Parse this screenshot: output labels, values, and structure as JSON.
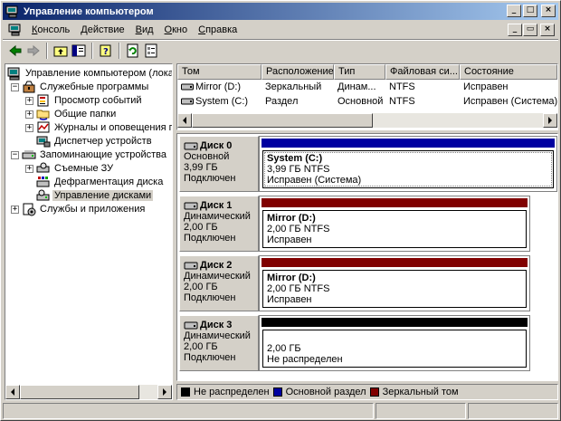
{
  "window": {
    "title": "Управление компьютером",
    "minimize_glyph": "_",
    "maximize_glyph": "□",
    "close_glyph": "×",
    "mdi_minimize_glyph": "_",
    "mdi_restore_glyph": "▭",
    "mdi_close_glyph": "×"
  },
  "menu": {
    "items": [
      {
        "underline": "К",
        "rest": "онсоль"
      },
      {
        "underline": "Д",
        "rest": "ействие"
      },
      {
        "underline": "В",
        "rest": "ид"
      },
      {
        "underline": "О",
        "rest": "кно"
      },
      {
        "underline": "С",
        "rest": "правка"
      }
    ]
  },
  "toolbar": {
    "icons": [
      "back-arrow-icon",
      "forward-arrow-icon",
      "up-folder-icon",
      "show-hide-tree-icon",
      "help-icon",
      "refresh-icon",
      "properties-icon"
    ]
  },
  "tree": {
    "items": [
      {
        "label": "Управление компьютером (локаль",
        "expander": "",
        "icon": "computer-management-icon"
      },
      {
        "label": "Служебные программы",
        "expander": "−",
        "icon": "system-tools-icon"
      },
      {
        "label": "Просмотр событий",
        "expander": "+",
        "icon": "event-viewer-icon"
      },
      {
        "label": "Общие папки",
        "expander": "+",
        "icon": "shared-folders-icon"
      },
      {
        "label": "Журналы и оповещения пр",
        "expander": "+",
        "icon": "logs-alerts-icon"
      },
      {
        "label": "Диспетчер устройств",
        "expander": "",
        "icon": "device-manager-icon"
      },
      {
        "label": "Запоминающие устройства",
        "expander": "−",
        "icon": "storage-icon"
      },
      {
        "label": "Съемные ЗУ",
        "expander": "+",
        "icon": "removable-storage-icon"
      },
      {
        "label": "Дефрагментация диска",
        "expander": "",
        "icon": "defrag-icon"
      },
      {
        "label": "Управление дисками",
        "expander": "",
        "icon": "disk-management-icon"
      },
      {
        "label": "Службы и приложения",
        "expander": "+",
        "icon": "services-apps-icon"
      }
    ]
  },
  "volumes": {
    "columns": [
      "Том",
      "Расположение",
      "Тип",
      "Файловая си...",
      "Состояние"
    ],
    "rows": [
      [
        "Mirror (D:)",
        "Зеркальный",
        "Динам...",
        "NTFS",
        "Исправен"
      ],
      [
        "System (C:)",
        "Раздел",
        "Основной",
        "NTFS",
        "Исправен (Система)"
      ]
    ]
  },
  "disks": [
    {
      "name": "Диск 0",
      "type": "Основной",
      "size": "3,99 ГБ",
      "status": "Подключен",
      "bar_color": "#0000a0",
      "volume": {
        "name": "System  (C:)",
        "size": "3,99 ГБ NTFS",
        "status": "Исправен (Система)"
      }
    },
    {
      "name": "Диск 1",
      "type": "Динамический",
      "size": "2,00 ГБ",
      "status": "Подключен",
      "bar_color": "#800000",
      "volume": {
        "name": "Mirror  (D:)",
        "size": "2,00 ГБ NTFS",
        "status": "Исправен"
      }
    },
    {
      "name": "Диск 2",
      "type": "Динамический",
      "size": "2,00 ГБ",
      "status": "Подключен",
      "bar_color": "#800000",
      "volume": {
        "name": "Mirror  (D:)",
        "size": "2,00 ГБ NTFS",
        "status": "Исправен"
      }
    },
    {
      "name": "Диск 3",
      "type": "Динамический",
      "size": "2,00 ГБ",
      "status": "Подключен",
      "bar_color": "#000000",
      "volume": {
        "name": "",
        "size": "2,00 ГБ",
        "status": "Не распределен"
      }
    }
  ],
  "legend": [
    {
      "label": "Не распределен",
      "color": "#000000"
    },
    {
      "label": "Основной раздел",
      "color": "#0000a0"
    },
    {
      "label": "Зеркальный том",
      "color": "#800000"
    }
  ]
}
